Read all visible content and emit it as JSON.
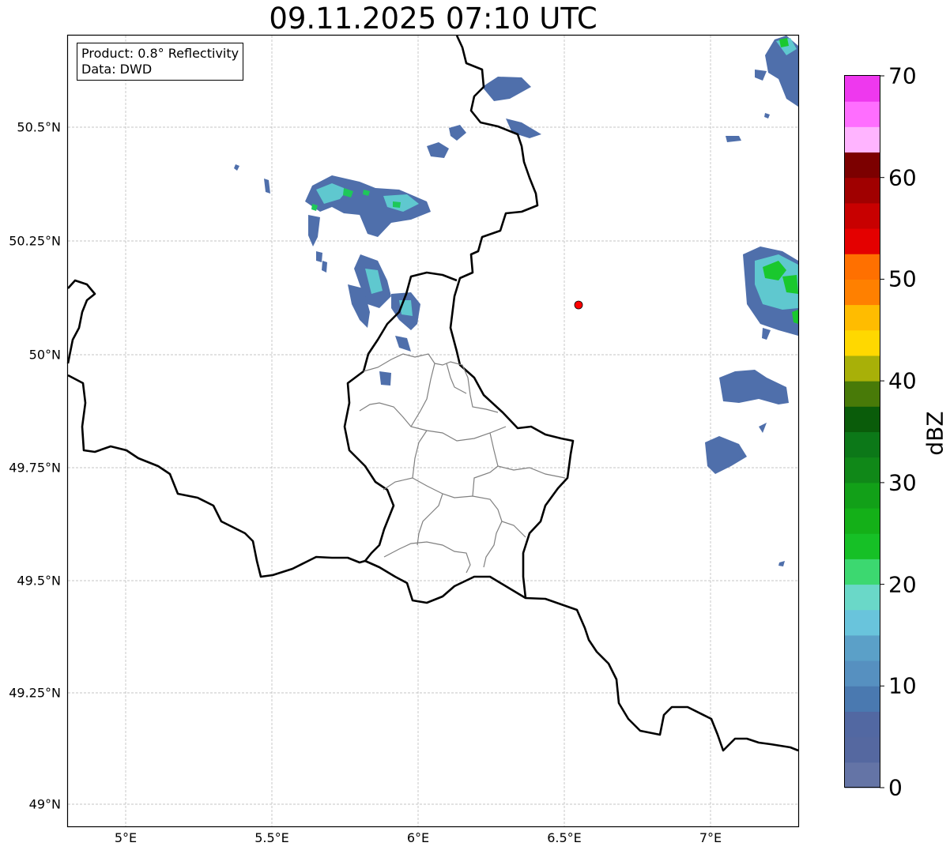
{
  "map": {
    "title": "09.11.2025 07:10 UTC",
    "info_box": {
      "product": "Product: 0.8° Reflectivity",
      "data_source": "Data: DWD"
    },
    "lat_ticks": [
      "50.5°N",
      "50.25°N",
      "50°N",
      "49.75°N",
      "49.5°N",
      "49.25°N",
      "49°N"
    ],
    "lon_ticks": [
      "5°E",
      "5.5°E",
      "6°E",
      "6.5°E",
      "7°E"
    ],
    "extent": {
      "lon_min": 4.8,
      "lon_max": 7.3,
      "lat_min": 48.95,
      "lat_max": 50.7
    },
    "gridlines": true,
    "marker": {
      "lon": 6.547,
      "lat": 50.11,
      "color": "#ff0000"
    },
    "colorbar": {
      "label": "dBZ",
      "ticks": [
        "0",
        "10",
        "20",
        "30",
        "40",
        "50",
        "60",
        "70"
      ],
      "range": [
        0,
        70
      ],
      "bin_size": 2.5,
      "colors": [
        "#6474a6",
        "#5568a0",
        "#5268a2",
        "#4260a8",
        "#4a79b0",
        "#5690c0",
        "#5ba0c8",
        "#69c4dc",
        "#6ad8c8",
        "#3cd870",
        "#1ac82e",
        "#16c026",
        "#14b018",
        "#12a018",
        "#108818",
        "#0c7818",
        "#0c6c14",
        "#0a5c0a",
        "#487a08",
        "#a8b008",
        "#ffd800",
        "#ffbc00",
        "#ffa200",
        "#ff8000",
        "#ff7000",
        "#e40000",
        "#c80000",
        "#a00000",
        "#7c0000",
        "#ffe0ff",
        "#ffb4ff",
        "#ff6eff",
        "#ee38ee"
      ]
    }
  }
}
